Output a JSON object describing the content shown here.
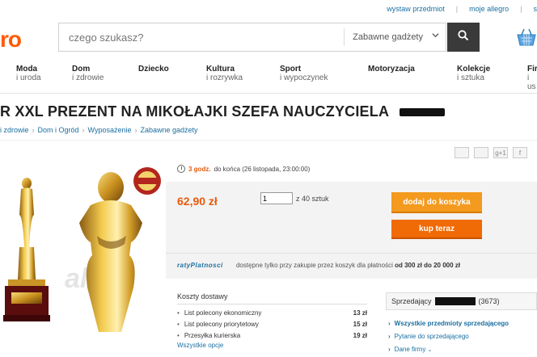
{
  "header": {
    "top_links": [
      "wystaw przedmiot",
      "moje allegro",
      "s"
    ],
    "logo_fragment": "ro",
    "search": {
      "placeholder": "czego szukasz?",
      "category": "Zabawne gadżety"
    }
  },
  "categories": [
    {
      "main": "Moda",
      "sub": "i uroda"
    },
    {
      "main": "Dom",
      "sub": "i zdrowie"
    },
    {
      "main": "Dziecko",
      "sub": ""
    },
    {
      "main": "Kultura",
      "sub": "i rozrywka"
    },
    {
      "main": "Sport",
      "sub": "i wypoczynek"
    },
    {
      "main": "Motoryzacja",
      "sub": ""
    },
    {
      "main": "Kolekcje",
      "sub": "i sztuka"
    },
    {
      "main": "Fir",
      "sub": "i us"
    }
  ],
  "product": {
    "title": "R XXL PREZENT NA MIKOŁAJKI SZEFA NAUCZYCIELA",
    "breadcrumb": [
      "i zdrowie",
      "Dom i Ogród",
      "Wyposażenie",
      "Zabawne gadżety"
    ],
    "social": [
      "",
      "",
      "g+1",
      "f"
    ],
    "timer": {
      "remaining": "3 godz.",
      "ends": "do końca (26 listopada, 23:00:00)"
    },
    "price": "62,90 zł",
    "quantity": "1",
    "quantity_label": "z 40 sztuk",
    "add_to_cart": "dodaj do koszyka",
    "buy_now": "kup teraz",
    "raty": {
      "brand": "ratyPlatnosci",
      "text": "dostępne tylko przy zakupie przez koszyk dla płatności",
      "range": "od 300 zł do 20 000 zł"
    }
  },
  "shipping": {
    "title": "Koszty dostawy",
    "rows": [
      {
        "label": "List polecony ekonomiczny",
        "value": "13 zł"
      },
      {
        "label": "List polecony priorytetowy",
        "value": "15 zł"
      },
      {
        "label": "Przesyłka kurierska",
        "value": "19 zł"
      }
    ],
    "more": "Wszystkie opcje"
  },
  "seller": {
    "label": "Sprzedający",
    "rating": "(3673)",
    "links": [
      "Wszystkie przedmioty sprzedającego",
      "Pytanie do sprzedającego",
      "Dane firmy"
    ]
  },
  "colors": {
    "accent": "#ff5a00",
    "link": "#1a6fa0",
    "cart_button": "#f39a1f",
    "buy_button": "#f06a05"
  }
}
